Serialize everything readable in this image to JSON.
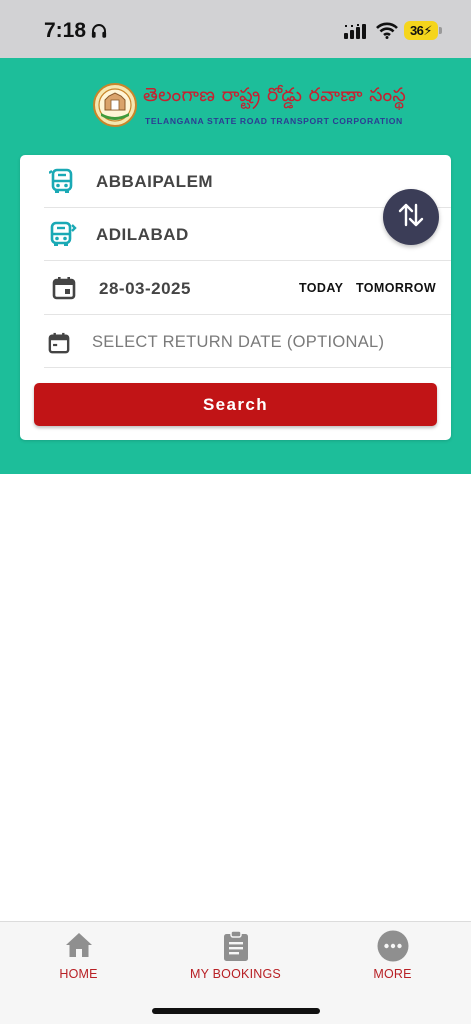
{
  "status_bar": {
    "time": "7:18",
    "battery": "36"
  },
  "header": {
    "brand_telugu": "తెలంగాణ రాష్ట్ర రోడ్డు రవాణా సంస్థ",
    "brand_english": "TELANGANA STATE ROAD TRANSPORT CORPORATION"
  },
  "search_form": {
    "from": "ABBAIPALEM",
    "to": "ADILABAD",
    "date": "28-03-2025",
    "today_label": "TODAY",
    "tomorrow_label": "TOMORROW",
    "return_placeholder": "SELECT RETURN DATE (OPTIONAL)",
    "search_label": "Search"
  },
  "bottom_nav": {
    "home": "HOME",
    "bookings": "MY BOOKINGS",
    "more": "MORE"
  },
  "colors": {
    "header_green": "#1dbe9a",
    "search_red": "#c11416",
    "swap_button": "#3b3d57",
    "nav_label": "#b82025",
    "bus_icon": "#1aa9b5"
  }
}
